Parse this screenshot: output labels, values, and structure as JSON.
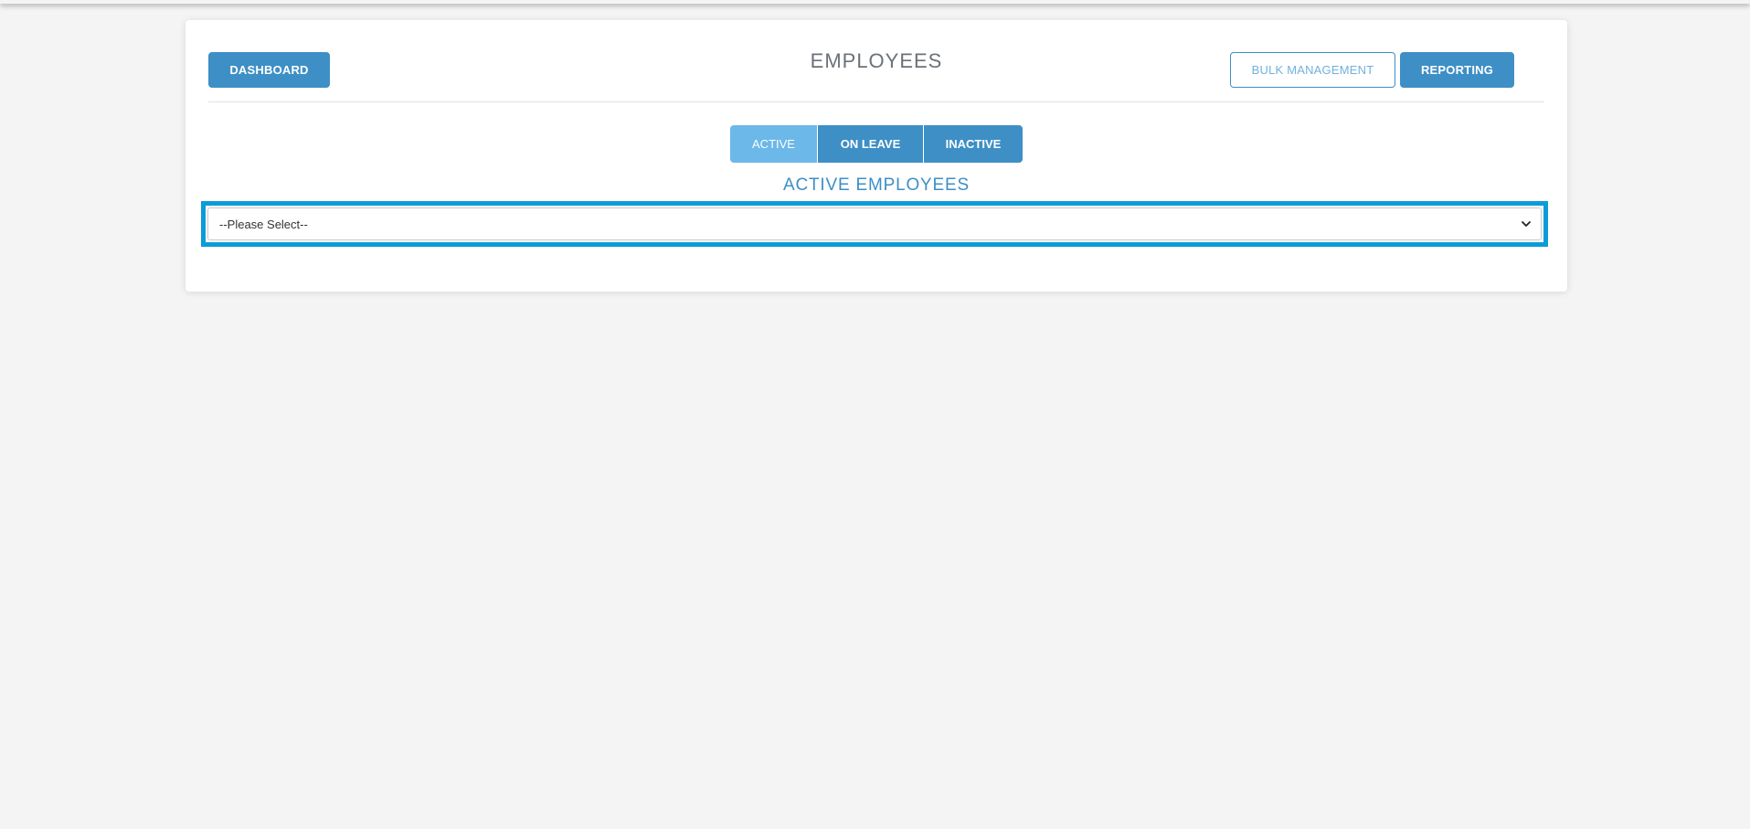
{
  "header": {
    "title": "EMPLOYEES",
    "dashboard_label": "DASHBOARD",
    "bulk_management_label": "BULK MANAGEMENT",
    "reporting_label": "REPORTING"
  },
  "tabs": [
    {
      "label": "ACTIVE",
      "selected": true
    },
    {
      "label": "ON LEAVE",
      "selected": false
    },
    {
      "label": "INACTIVE",
      "selected": false
    }
  ],
  "section": {
    "title": "ACTIVE EMPLOYEES"
  },
  "employee_select": {
    "selected_value": "--Please Select--"
  },
  "colors": {
    "primary": "#3d8fc6",
    "tab_selected": "#6cb8e8",
    "focus_border": "#0d9bd8",
    "background": "#f4f4f4"
  },
  "icons": {
    "select_chevron": "chevron-down-icon"
  }
}
